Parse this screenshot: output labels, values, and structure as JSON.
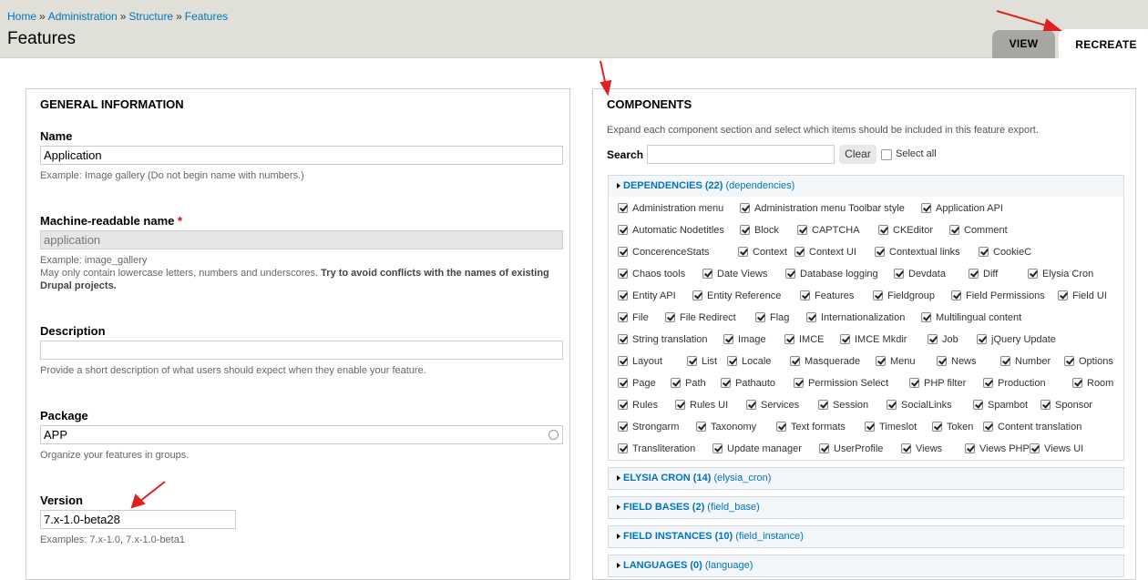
{
  "breadcrumb": {
    "items": [
      "Home",
      "Administration",
      "Structure",
      "Features"
    ],
    "separator": "»"
  },
  "page_title": "Features",
  "tabs": {
    "view": "VIEW",
    "recreate": "RECREATE"
  },
  "general": {
    "legend": "GENERAL INFORMATION",
    "name_label": "Name",
    "name_value": "Application",
    "name_desc": "Example: Image gallery (Do not begin name with numbers.)",
    "machine_label": "Machine-readable name",
    "machine_required": "*",
    "machine_value": "application",
    "machine_desc_1": "Example: image_gallery",
    "machine_desc_2": "May only contain lowercase letters, numbers and underscores.",
    "machine_desc_bold": "Try to avoid conflicts with the names of existing Drupal projects.",
    "description_label": "Description",
    "description_value": "",
    "description_desc": "Provide a short description of what users should expect when they enable your feature.",
    "package_label": "Package",
    "package_value": "APP",
    "package_desc": "Organize your features in groups.",
    "version_label": "Version",
    "version_value": "7.x-1.0-beta28",
    "version_desc": "Examples: 7.x-1.0, 7.x-1.0-beta1"
  },
  "components": {
    "legend": "COMPONENTS",
    "help": "Expand each component section and select which items should be included in this feature export.",
    "search_label": "Search",
    "search_value": "",
    "clear_label": "Clear",
    "select_all_label": "Select all",
    "sections": {
      "dependencies": {
        "title": "DEPENDENCIES (22)",
        "machine": "(dependencies)"
      },
      "elysia": {
        "title": "ELYSIA CRON (14)",
        "machine": "(elysia_cron)"
      },
      "fieldbases": {
        "title": "FIELD BASES (2)",
        "machine": "(field_base)"
      },
      "fieldinst": {
        "title": "FIELD INSTANCES (10)",
        "machine": "(field_instance)"
      },
      "languages": {
        "title": "LANGUAGES (0)",
        "machine": "(language)"
      }
    },
    "dependency_rows": [
      [
        "Administration menu",
        "Administration menu Toolbar style",
        "Application API"
      ],
      [
        "Automatic Nodetitles",
        "Block",
        "CAPTCHA",
        "CKEditor",
        "Comment"
      ],
      [
        "ConcerenceStats",
        "Context",
        "Context UI",
        "Contextual links",
        "CookieC"
      ],
      [
        "Chaos tools",
        "Date Views",
        "Database logging",
        "Devdata",
        "Diff",
        "Elysia Cron"
      ],
      [
        "Entity API",
        "Entity Reference",
        "Features",
        "Fieldgroup",
        "Field Permissions",
        "Field UI"
      ],
      [
        "File",
        "File Redirect",
        "Flag",
        "Internationalization",
        "Multilingual content"
      ],
      [
        "String translation",
        "Image",
        "IMCE",
        "IMCE Mkdir",
        "Job",
        "jQuery Update"
      ],
      [
        "Layout",
        "List",
        "Locale",
        "Masquerade",
        "Menu",
        "News",
        "Number",
        "Options"
      ],
      [
        "Page",
        "Path",
        "Pathauto",
        "Permission Select",
        "PHP filter",
        "Production",
        "Room"
      ],
      [
        "Rules",
        "Rules UI",
        "Services",
        "Session",
        "SocialLinks",
        "Spambot",
        "Sponsor"
      ],
      [
        "Strongarm",
        "Taxonomy",
        "Text formats",
        "Timeslot",
        "Token",
        "Content translation"
      ],
      [
        "Transliteration",
        "Update manager",
        "UserProfile",
        "Views",
        "Views PHP",
        "Views UI"
      ]
    ]
  },
  "colors": {
    "link": "#0074bd",
    "arrow": "#e02020",
    "header_bg": "#e0e0d8"
  }
}
